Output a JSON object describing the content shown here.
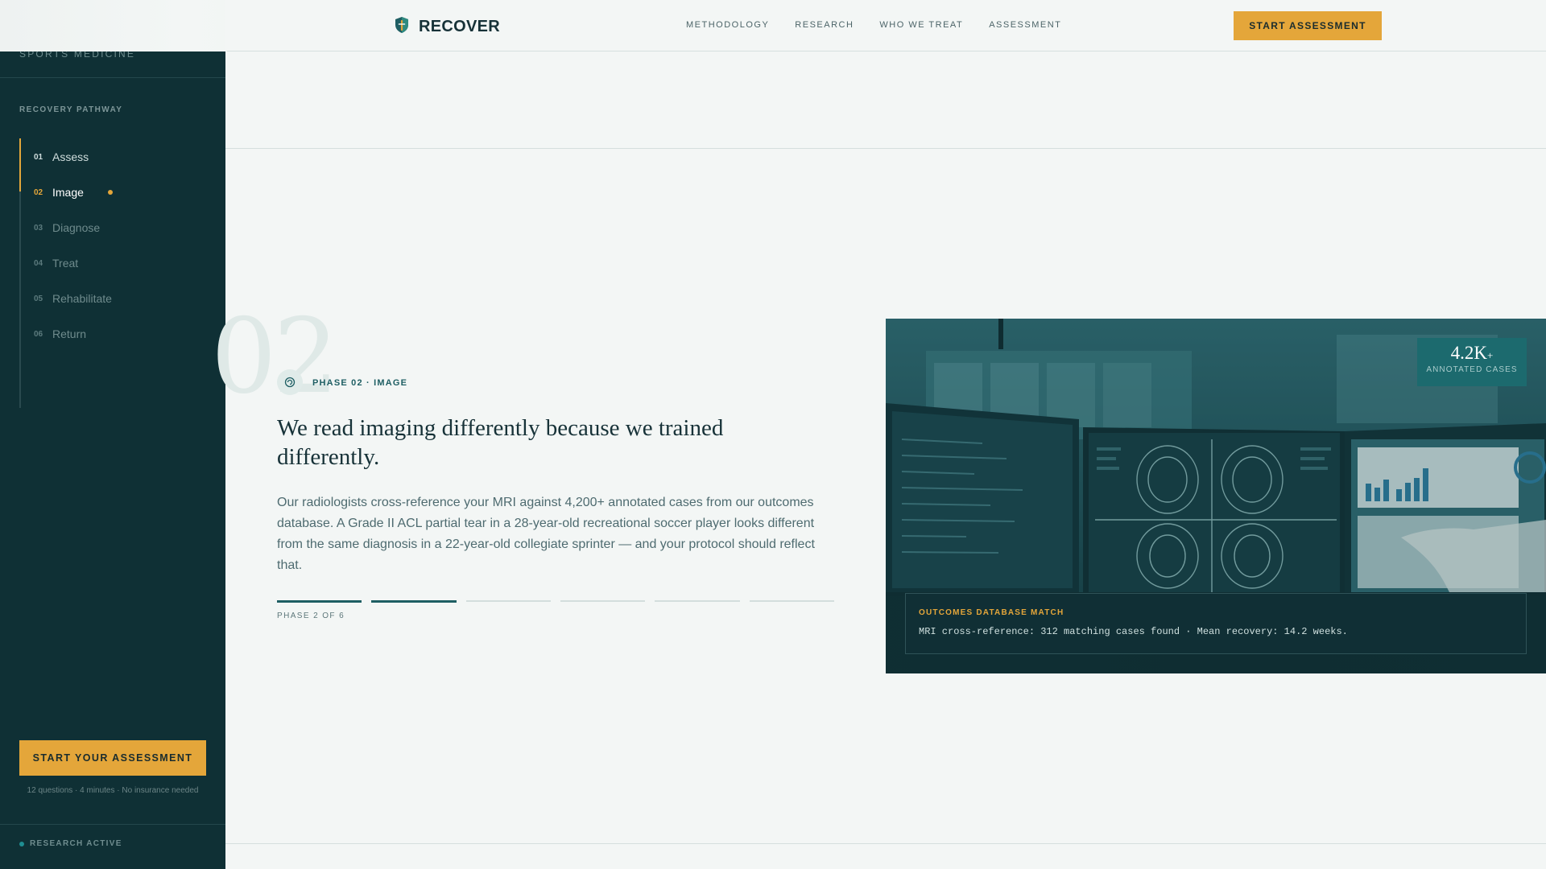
{
  "colors": {
    "accent": "#e4a63a",
    "sidebar_bg": "#0f3035",
    "teal": "#1e5e63",
    "page_bg": "#f3f6f5"
  },
  "sidebar": {
    "brand_subtitle": "SPORTS MEDICINE",
    "section_title": "RECOVERY PATHWAY",
    "steps": [
      {
        "num": "01",
        "label": "Assess",
        "state": "done"
      },
      {
        "num": "02",
        "label": "Image",
        "state": "active"
      },
      {
        "num": "03",
        "label": "Diagnose",
        "state": "upcoming"
      },
      {
        "num": "04",
        "label": "Treat",
        "state": "upcoming"
      },
      {
        "num": "05",
        "label": "Rehabilitate",
        "state": "upcoming"
      },
      {
        "num": "06",
        "label": "Return",
        "state": "upcoming"
      }
    ],
    "cta_label": "START YOUR ASSESSMENT",
    "cta_meta": "12 questions · 4 minutes · No insurance needed",
    "status_text": "RESEARCH ACTIVE"
  },
  "header": {
    "logo_text": "RECOVER",
    "logo_icon": "shield-icon",
    "nav": [
      "METHODOLOGY",
      "RESEARCH",
      "WHO WE TREAT",
      "ASSESSMENT"
    ],
    "cta_label": "START ASSESSMENT"
  },
  "phase": {
    "big_number": "02",
    "icon": "scan-icon",
    "label": "PHASE 02 · IMAGE",
    "headline": "We read imaging differently because we trained differently.",
    "body": "Our radiologists cross-reference your MRI against 4,200+ annotated cases from our outcomes database. A Grade II ACL partial tear in a 28-year-old recreational soccer player looks different from the same diagnosis in a 22-year-old collegiate sprinter — and your protocol should reflect that.",
    "progress": {
      "current": 2,
      "total": 6
    },
    "progress_text": "PHASE 2 OF 6"
  },
  "panel": {
    "stat_value": "4.2K",
    "stat_suffix": "+",
    "stat_label": "ANNOTATED CASES",
    "match_title": "OUTCOMES DATABASE MATCH",
    "match_text": "MRI cross-reference: 312 matching cases found · Mean recovery: 14.2 weeks."
  }
}
